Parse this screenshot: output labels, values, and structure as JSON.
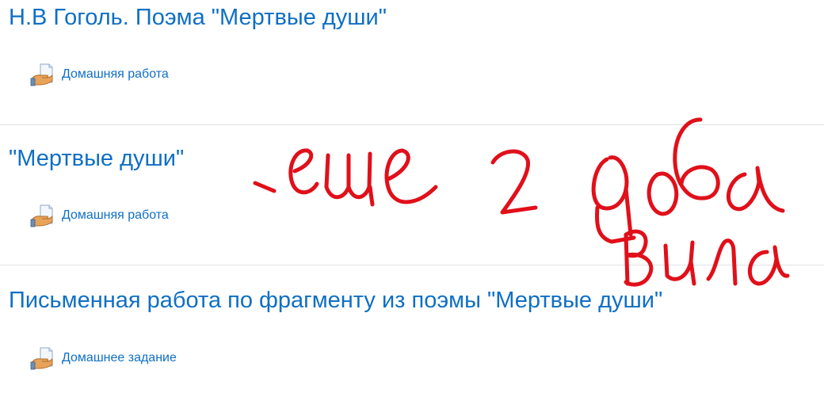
{
  "sections": [
    {
      "title": "Н.В Гоголь. Поэма \"Мертвые души\"",
      "activity": {
        "label": "Домашняя работа",
        "icon": "assignment-icon"
      }
    },
    {
      "title": "\"Мертвые души\"",
      "activity": {
        "label": "Домашняя работа",
        "icon": "assignment-icon"
      }
    },
    {
      "title": "Письменная работа по фрагменту из поэмы \"Мертвые души\"",
      "activity": {
        "label": "Домашнее задание",
        "icon": "assignment-icon"
      }
    }
  ],
  "annotation": {
    "text": ".еще 2 доба вила",
    "color": "#e0101a"
  },
  "colors": {
    "link": "#0f6fc5",
    "divider": "#dee2e6"
  }
}
